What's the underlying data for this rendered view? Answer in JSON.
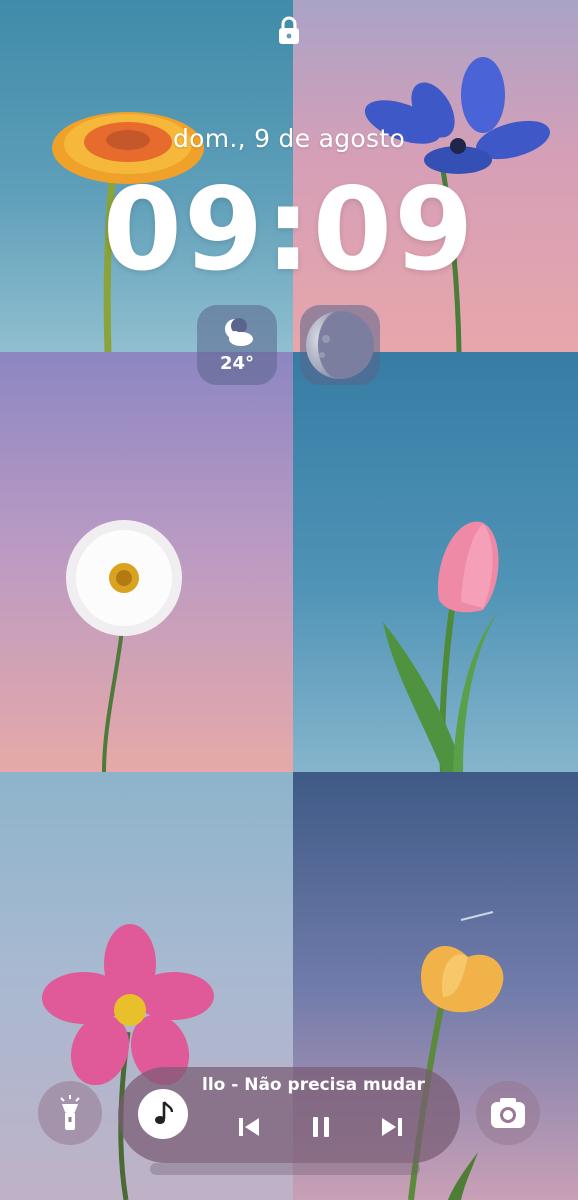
{
  "lockscreen": {
    "date": "dom., 9 de agosto",
    "time": "09:09"
  },
  "widgets": {
    "weather": {
      "icon": "weather-moon-cloud-icon",
      "temperature": "24°"
    },
    "moon_phase": {
      "icon": "moon-phase-icon"
    }
  },
  "shortcuts": {
    "left": {
      "icon": "flashlight-icon"
    },
    "right": {
      "icon": "camera-icon"
    }
  },
  "media_player": {
    "song": "llo - Não precisa mudar",
    "icons": [
      "music-note-icon",
      "previous-icon",
      "pause-icon",
      "next-icon"
    ]
  },
  "colors": {
    "text": "#ffffff",
    "widget_bg": "#5a648c",
    "player_bg": "#785c73"
  }
}
